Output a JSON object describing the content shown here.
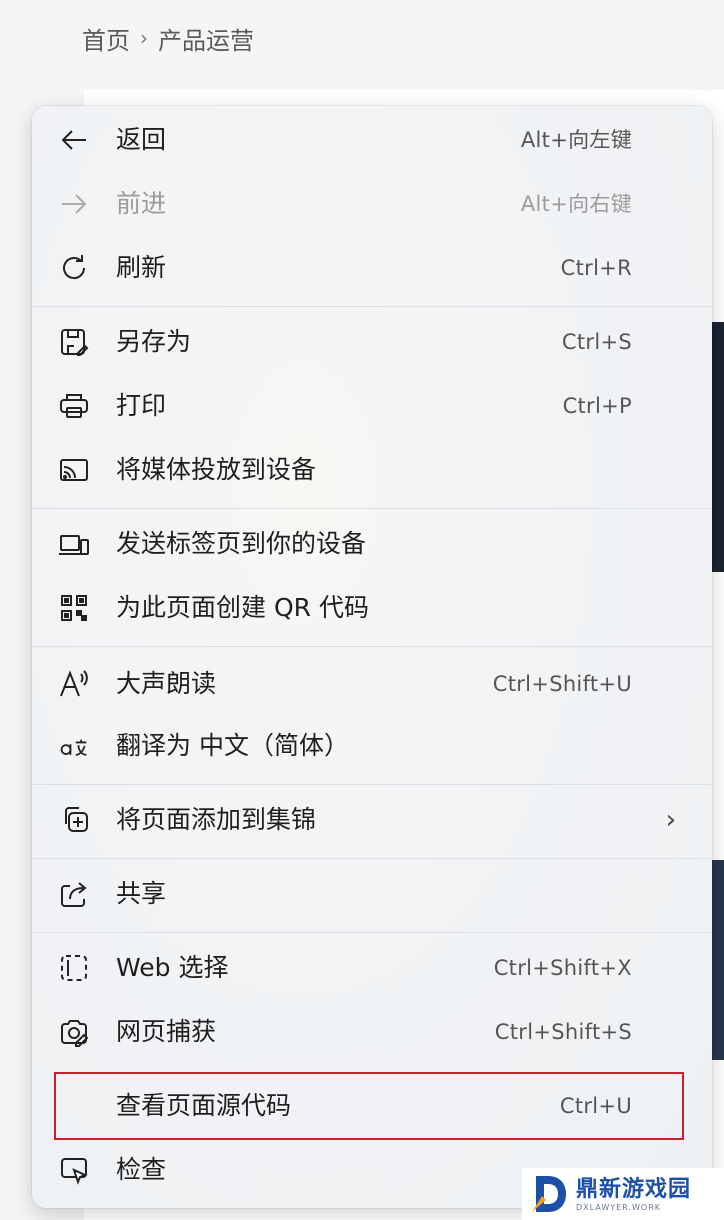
{
  "breadcrumb": {
    "home": "首页",
    "separator": "›",
    "current": "产品运营"
  },
  "menu": {
    "items": [
      {
        "icon": "back-arrow-icon",
        "label": "返回",
        "shortcut": "Alt+向左键",
        "disabled": false
      },
      {
        "icon": "forward-arrow-icon",
        "label": "前进",
        "shortcut": "Alt+向右键",
        "disabled": true
      },
      {
        "icon": "refresh-icon",
        "label": "刷新",
        "shortcut": "Ctrl+R",
        "disabled": false
      },
      {
        "icon": "save-icon",
        "label": "另存为",
        "shortcut": "Ctrl+S",
        "disabled": false
      },
      {
        "icon": "print-icon",
        "label": "打印",
        "shortcut": "Ctrl+P",
        "disabled": false
      },
      {
        "icon": "cast-icon",
        "label": "将媒体投放到设备",
        "shortcut": "",
        "disabled": false
      },
      {
        "icon": "send-tab-icon",
        "label": "发送标签页到你的设备",
        "shortcut": "",
        "disabled": false
      },
      {
        "icon": "qr-code-icon",
        "label": "为此页面创建 QR 代码",
        "shortcut": "",
        "disabled": false
      },
      {
        "icon": "read-aloud-icon",
        "label": "大声朗读",
        "shortcut": "Ctrl+Shift+U",
        "disabled": false
      },
      {
        "icon": "translate-icon",
        "label": "翻译为 中文（简体）",
        "shortcut": "",
        "disabled": false
      },
      {
        "icon": "add-collection-icon",
        "label": "将页面添加到集锦",
        "shortcut": "",
        "disabled": false,
        "submenu": "›"
      },
      {
        "icon": "share-icon",
        "label": "共享",
        "shortcut": "",
        "disabled": false
      },
      {
        "icon": "web-select-icon",
        "label": "Web 选择",
        "shortcut": "Ctrl+Shift+X",
        "disabled": false
      },
      {
        "icon": "web-capture-icon",
        "label": "网页捕获",
        "shortcut": "Ctrl+Shift+S",
        "disabled": false
      },
      {
        "icon": "",
        "label": "查看页面源代码",
        "shortcut": "Ctrl+U",
        "disabled": false,
        "highlighted": true
      },
      {
        "icon": "inspect-icon",
        "label": "检查",
        "shortcut": "",
        "disabled": false
      }
    ]
  },
  "watermark": {
    "title": "鼎新游戏园",
    "subtitle": "DXLAWYER.WORK"
  },
  "colors": {
    "highlight_border": "#c8202b",
    "watermark_blue": "#1c4fa8"
  }
}
